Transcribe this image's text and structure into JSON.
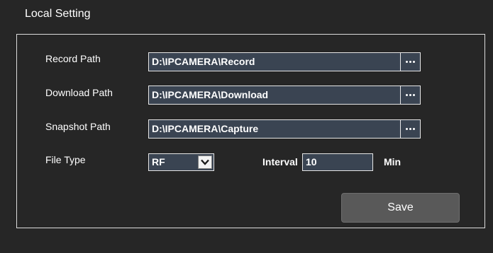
{
  "panel": {
    "title": "Local Setting"
  },
  "record": {
    "label": "Record Path",
    "value": "D:\\IPCAMERA\\Record",
    "browse_icon": "ellipsis-icon"
  },
  "download": {
    "label": "Download Path",
    "value": "D:\\IPCAMERA\\Download",
    "browse_icon": "ellipsis-icon"
  },
  "snapshot": {
    "label": "Snapshot Path",
    "value": "D:\\IPCAMERA\\Capture",
    "browse_icon": "ellipsis-icon"
  },
  "file_type": {
    "label": "File Type",
    "selected": "RF",
    "arrow_icon": "chevron-down-icon"
  },
  "interval": {
    "label": "Interval",
    "value": "10",
    "unit": "Min"
  },
  "actions": {
    "save_label": "Save"
  },
  "colors": {
    "background": "#262626",
    "field_background": "#3a4452",
    "border": "#e6e6e6",
    "button_background": "#595959"
  }
}
